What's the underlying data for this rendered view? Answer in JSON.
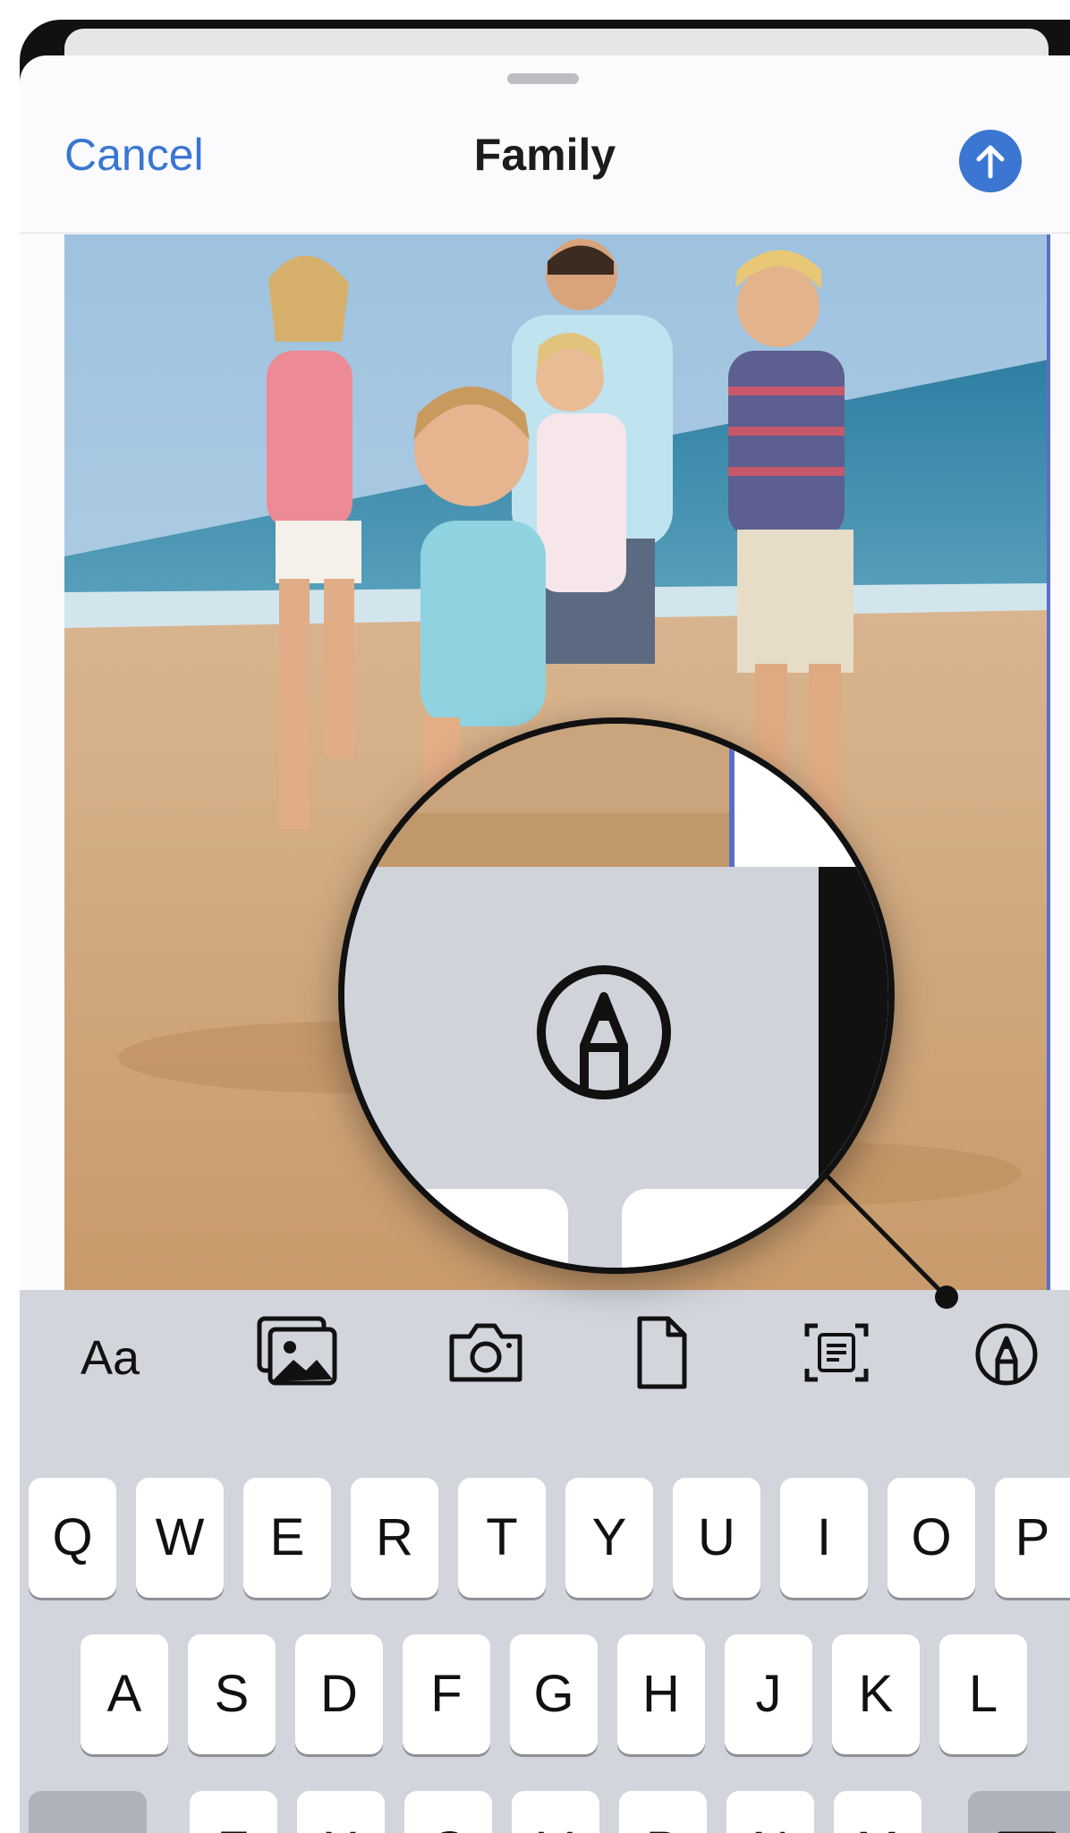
{
  "header": {
    "cancel_label": "Cancel",
    "title": "Family",
    "send_icon": "arrow-up-circle-icon"
  },
  "toolbar": {
    "text_format_label": "Aa",
    "icons": [
      "text-format-icon",
      "photo-library-icon",
      "camera-icon",
      "document-icon",
      "scan-text-icon",
      "markup-icon"
    ]
  },
  "keyboard": {
    "row1": [
      "Q",
      "W",
      "E",
      "R",
      "T",
      "Y",
      "U",
      "I",
      "O",
      "P"
    ],
    "row2": [
      "A",
      "S",
      "D",
      "F",
      "G",
      "H",
      "J",
      "K",
      "L"
    ],
    "row3": [
      "Z",
      "X",
      "C",
      "V",
      "B",
      "N",
      "M"
    ],
    "shift_icon": "shift-icon",
    "delete_icon": "delete-icon"
  },
  "magnifier": {
    "highlighted_icon": "markup-icon"
  },
  "colors": {
    "accent": "#3a76d2",
    "keyboard_bg": "#d3d5dc",
    "key_bg": "#ffffff"
  }
}
